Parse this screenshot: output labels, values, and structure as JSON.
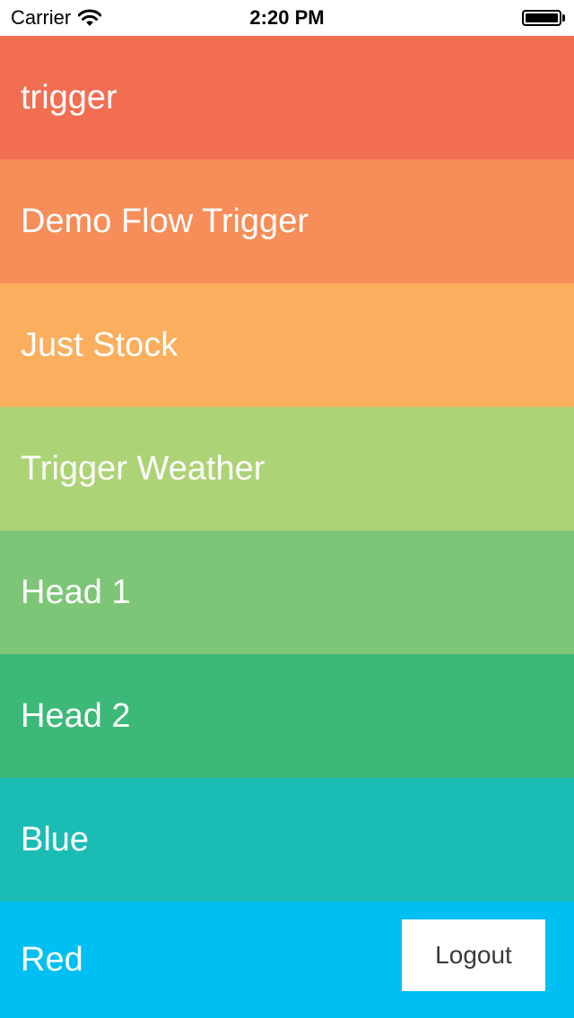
{
  "status_bar": {
    "carrier": "Carrier",
    "time": "2:20 PM",
    "battery_level": 1.0
  },
  "list": {
    "items": [
      {
        "label": "trigger",
        "color": "#f26e52"
      },
      {
        "label": "Demo Flow Trigger",
        "color": "#f78d58"
      },
      {
        "label": "Just Stock",
        "color": "#fbae5d"
      },
      {
        "label": "Trigger Weather",
        "color": "#acd375"
      },
      {
        "label": "Head 1",
        "color": "#7dc677"
      },
      {
        "label": "Head 2",
        "color": "#3cb878"
      },
      {
        "label": "Blue",
        "color": "#1bbcb4"
      },
      {
        "label": "Red",
        "color": "#00bff3"
      }
    ]
  },
  "logout": {
    "label": "Logout"
  }
}
